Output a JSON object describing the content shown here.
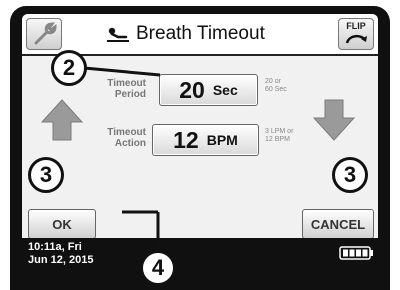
{
  "header": {
    "title": "Breath Timeout",
    "title_icon": "patient-lying-icon",
    "left_icon": "wrench-icon",
    "flip_label": "FLIP"
  },
  "fields": [
    {
      "label_line1": "Timeout",
      "label_line2": "Period",
      "value": "20",
      "unit": "Sec",
      "hint_line1": "20 or",
      "hint_line2": "60 Sec"
    },
    {
      "label_line1": "Timeout",
      "label_line2": "Action",
      "value": "12",
      "unit": "BPM",
      "hint_line1": "3 LPM or",
      "hint_line2": "12 BPM"
    }
  ],
  "buttons": {
    "ok": "OK",
    "cancel": "CANCEL"
  },
  "status": {
    "time": "10:11a, Fri",
    "date": "Jun 12, 2015",
    "battery_icon": "battery-full-icon"
  },
  "callouts": {
    "value_callout": "2",
    "left_arrow_callout": "3",
    "right_arrow_callout": "3",
    "ok_callout": "4"
  },
  "colors": {
    "arrow": "#9a9a9a",
    "bezel": "#101010"
  }
}
